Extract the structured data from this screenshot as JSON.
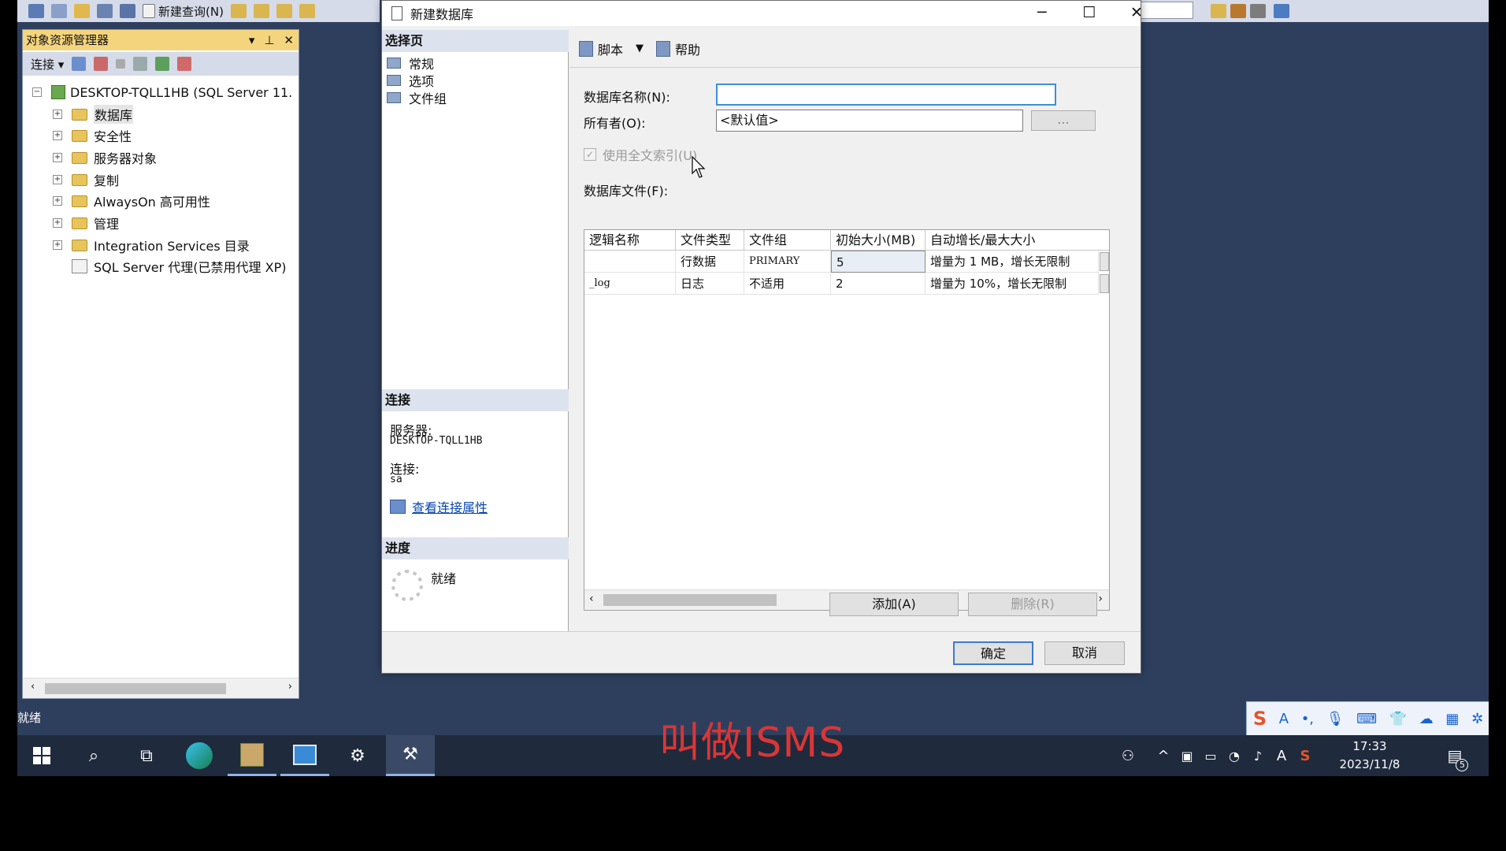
{
  "ssms": {
    "toolbar": {
      "new_query": "新建查询(N)"
    }
  },
  "object_explorer": {
    "title": "对象资源管理器",
    "connect": "连接",
    "root": "DESKTOP-TQLL1HB (SQL Server 11.",
    "items": [
      {
        "label": "数据库"
      },
      {
        "label": "安全性"
      },
      {
        "label": "服务器对象"
      },
      {
        "label": "复制"
      },
      {
        "label": "AlwaysOn 高可用性"
      },
      {
        "label": "管理"
      },
      {
        "label": "Integration Services 目录"
      },
      {
        "label": "SQL Server 代理(已禁用代理 XP)"
      }
    ]
  },
  "status_bar": {
    "text": "就绪"
  },
  "dialog": {
    "title": "新建数据库",
    "select_page": {
      "header": "选择页",
      "items": [
        "常规",
        "选项",
        "文件组"
      ]
    },
    "connection": {
      "header": "连接",
      "server_label": "服务器:",
      "server_value": "DESKTOP-TQLL1HB",
      "connection_label": "连接:",
      "connection_value": "sa",
      "view_link": "查看连接属性"
    },
    "progress": {
      "header": "进度",
      "status": "就绪"
    },
    "toolbar": {
      "script": "脚本",
      "help": "帮助"
    },
    "db_name_label": "数据库名称(N):",
    "db_name_value": "",
    "owner_label": "所有者(O):",
    "owner_value": "<默认值>",
    "owner_browse": "...",
    "fulltext_label": "使用全文索引(U)",
    "files_label": "数据库文件(F):",
    "grid": {
      "headers": [
        "逻辑名称",
        "文件类型",
        "文件组",
        "初始大小(MB)",
        "自动增长/最大大小"
      ],
      "rows": [
        {
          "name": "",
          "type": "行数据",
          "filegroup": "PRIMARY",
          "size": "5",
          "growth": "增量为 1 MB，增长无限制"
        },
        {
          "name": "_log",
          "type": "日志",
          "filegroup": "不适用",
          "size": "2",
          "growth": "增量为 10%，增长无限制"
        }
      ]
    },
    "add_button": "添加(A)",
    "remove_button": "删除(R)",
    "ok_button": "确定",
    "cancel_button": "取消"
  },
  "taskbar": {
    "time": "17:33",
    "date": "2023/11/8",
    "notification_count": "5",
    "ime_letter": "A"
  },
  "overlay_caption": "叫做ISMS"
}
